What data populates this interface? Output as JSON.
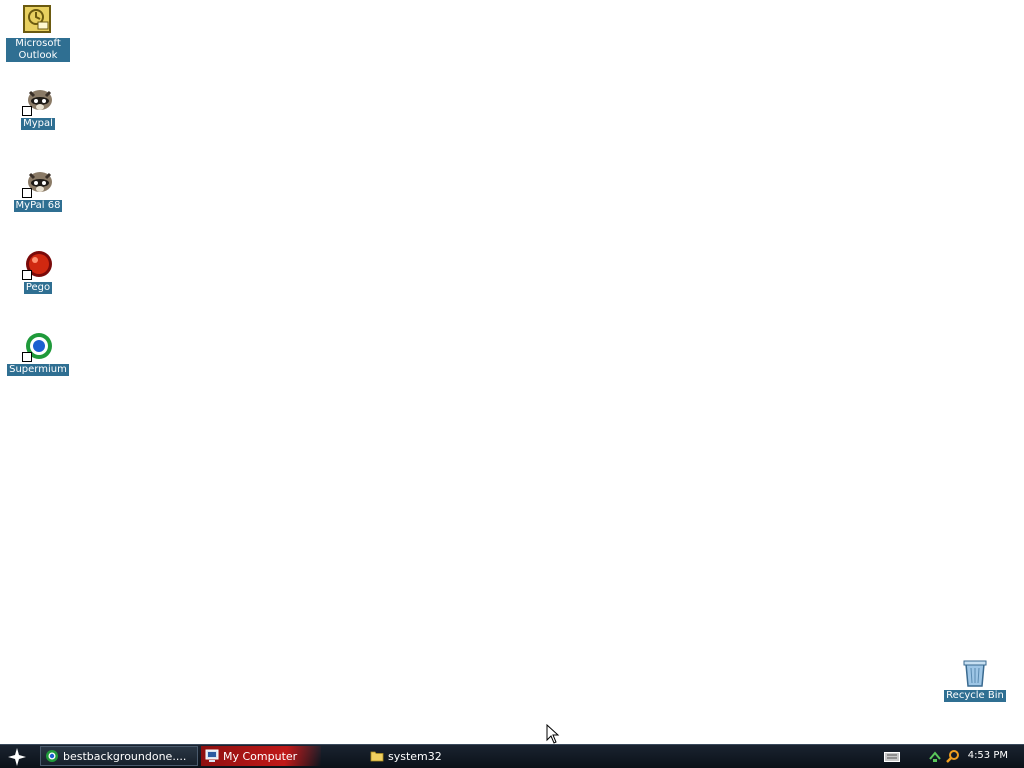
{
  "desktop": {
    "icons": [
      {
        "label": "Microsoft Outlook",
        "icon": "outlook-icon"
      },
      {
        "label": "Mypal",
        "icon": "mypal-raccoon-icon"
      },
      {
        "label": "MyPal 68",
        "icon": "mypal68-raccoon-icon"
      },
      {
        "label": "Pego",
        "icon": "pego-icon"
      },
      {
        "label": "Supermium",
        "icon": "supermium-icon"
      }
    ],
    "recycle_bin": {
      "label": "Recycle Bin",
      "icon": "recycle-bin-icon"
    }
  },
  "taskbar": {
    "start_icon": "start-star-icon",
    "buttons": [
      {
        "label": "bestbackgroundone....",
        "icon": "browser-globe-icon"
      },
      {
        "label": "My Computer",
        "icon": "my-computer-icon"
      },
      {
        "label": "system32",
        "icon": "folder-icon"
      }
    ],
    "tray": {
      "icons": [
        "keyboard-icon",
        "network-icon",
        "search-icon"
      ],
      "clock": "4:53 PM"
    }
  },
  "colors": {
    "desktop_background": "#ffffff",
    "icon_label_background": "#2f6f92",
    "taskbar": "#0b1118",
    "active_task": "#c01818"
  }
}
